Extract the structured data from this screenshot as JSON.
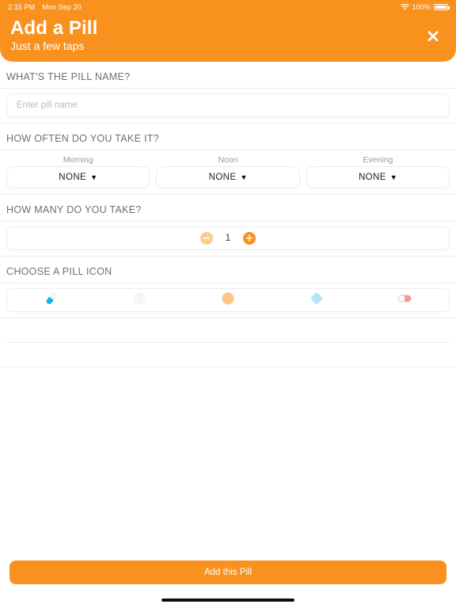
{
  "status_bar": {
    "time": "2:15 PM",
    "date": "Mon Sep 20",
    "battery_percent": "100%",
    "wifi_icon": "wifi-icon",
    "battery_icon": "battery-icon"
  },
  "header": {
    "title": "Add a Pill",
    "subtitle": "Just a few taps",
    "close_label": "×",
    "background_color": "#f9911e"
  },
  "sections": {
    "pill_name": {
      "label": "WHAT'S THE PILL NAME?",
      "placeholder": "Enter pill name",
      "value": ""
    },
    "frequency": {
      "label": "HOW OFTEN DO YOU TAKE IT?",
      "options": [
        {
          "time_label": "Morning",
          "value": "NONE"
        },
        {
          "time_label": "Noon",
          "value": "NONE"
        },
        {
          "time_label": "Evening",
          "value": "NONE"
        }
      ],
      "caret": "▼"
    },
    "quantity": {
      "label": "HOW MANY DO YOU TAKE?",
      "value": "1",
      "minus_label": "−",
      "plus_label": "+",
      "minus_color": "#fbcb90",
      "plus_color": "#f9911e"
    },
    "pill_icon": {
      "label": "CHOOSE A PILL ICON",
      "icons": [
        {
          "name": "capsule-blue-icon",
          "color": "#29b6f6",
          "selected": true
        },
        {
          "name": "tablet-round-white-icon",
          "color": "#f2f2f4",
          "selected": false
        },
        {
          "name": "tablet-round-orange-icon",
          "color": "#fbc98c",
          "selected": false
        },
        {
          "name": "diamond-blue-icon",
          "color": "#b3e3f7",
          "selected": false
        },
        {
          "name": "capsule-pink-icon",
          "color": "#fb9aa2",
          "selected": false
        }
      ]
    }
  },
  "footer": {
    "submit_label": "Add this Pill",
    "submit_color": "#f9911e"
  }
}
